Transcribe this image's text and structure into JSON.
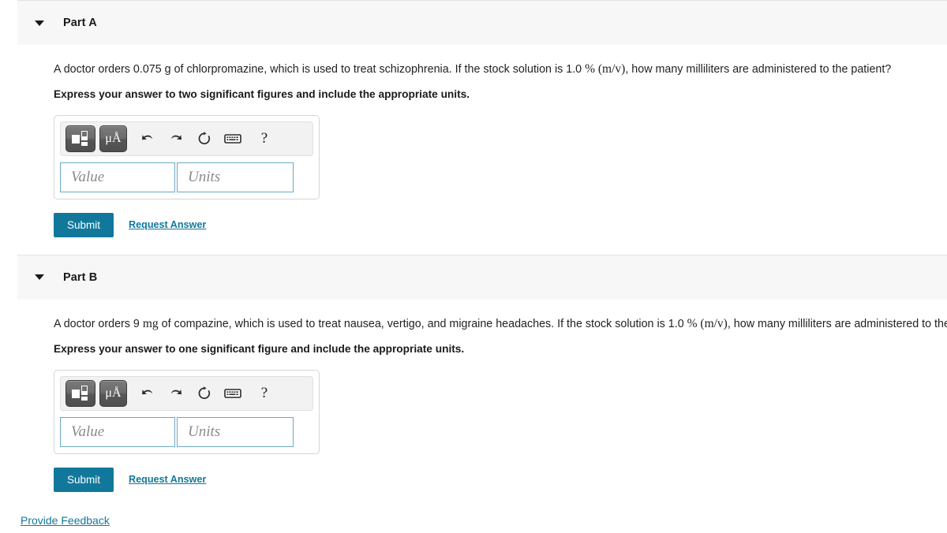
{
  "parts": [
    {
      "id": "part-a",
      "title": "Part A",
      "caret_icon": "chevron-down-icon",
      "question_segments": [
        {
          "text": "A doctor orders 0.075 g of chlorpromazine, which is used to treat schizophrenia. If the stock solution is 1.0 ",
          "math": false
        },
        {
          "text": "% (m/v)",
          "math": true
        },
        {
          "text": ", how many milliliters are administered to the patient?",
          "math": false
        }
      ],
      "instruction": "Express your answer to two significant figures and include the appropriate units.",
      "toolbar": {
        "template_button": "template-icon",
        "units_button": "μÅ",
        "undo_icon": "undo-arrow-icon",
        "redo_icon": "redo-arrow-icon",
        "reset_icon": "reset-circular-arrow-icon",
        "keyboard_icon": "keyboard-icon",
        "help_icon": "?"
      },
      "inputs": {
        "value_placeholder": "Value",
        "value_text": "",
        "units_placeholder": "Units",
        "units_text": ""
      },
      "submit_label": "Submit",
      "request_answer_label": "Request Answer"
    },
    {
      "id": "part-b",
      "title": "Part B",
      "caret_icon": "chevron-down-icon",
      "question_segments": [
        {
          "text": "A doctor orders 9 ",
          "math": false
        },
        {
          "text": "mg",
          "math": true
        },
        {
          "text": " of compazine, which is used to treat nausea, vertigo, and migraine headaches. If the stock solution is 1.0 ",
          "math": false
        },
        {
          "text": "% (m/v)",
          "math": true
        },
        {
          "text": ", how many milliliters are administered to the patient?",
          "math": false
        }
      ],
      "instruction": "Express your answer to one significant figure and include the appropriate units.",
      "toolbar": {
        "template_button": "template-icon",
        "units_button": "μÅ",
        "undo_icon": "undo-arrow-icon",
        "redo_icon": "redo-arrow-icon",
        "reset_icon": "reset-circular-arrow-icon",
        "keyboard_icon": "keyboard-icon",
        "help_icon": "?"
      },
      "inputs": {
        "value_placeholder": "Value",
        "value_text": "",
        "units_placeholder": "Units",
        "units_text": ""
      },
      "submit_label": "Submit",
      "request_answer_label": "Request Answer"
    }
  ],
  "footer": {
    "feedback_label": "Provide Feedback"
  },
  "colors": {
    "accent": "#11789c",
    "header_band": "#f7f7f7",
    "input_border": "#6da9c3",
    "toolbar_bg": "#f2f2f2"
  }
}
